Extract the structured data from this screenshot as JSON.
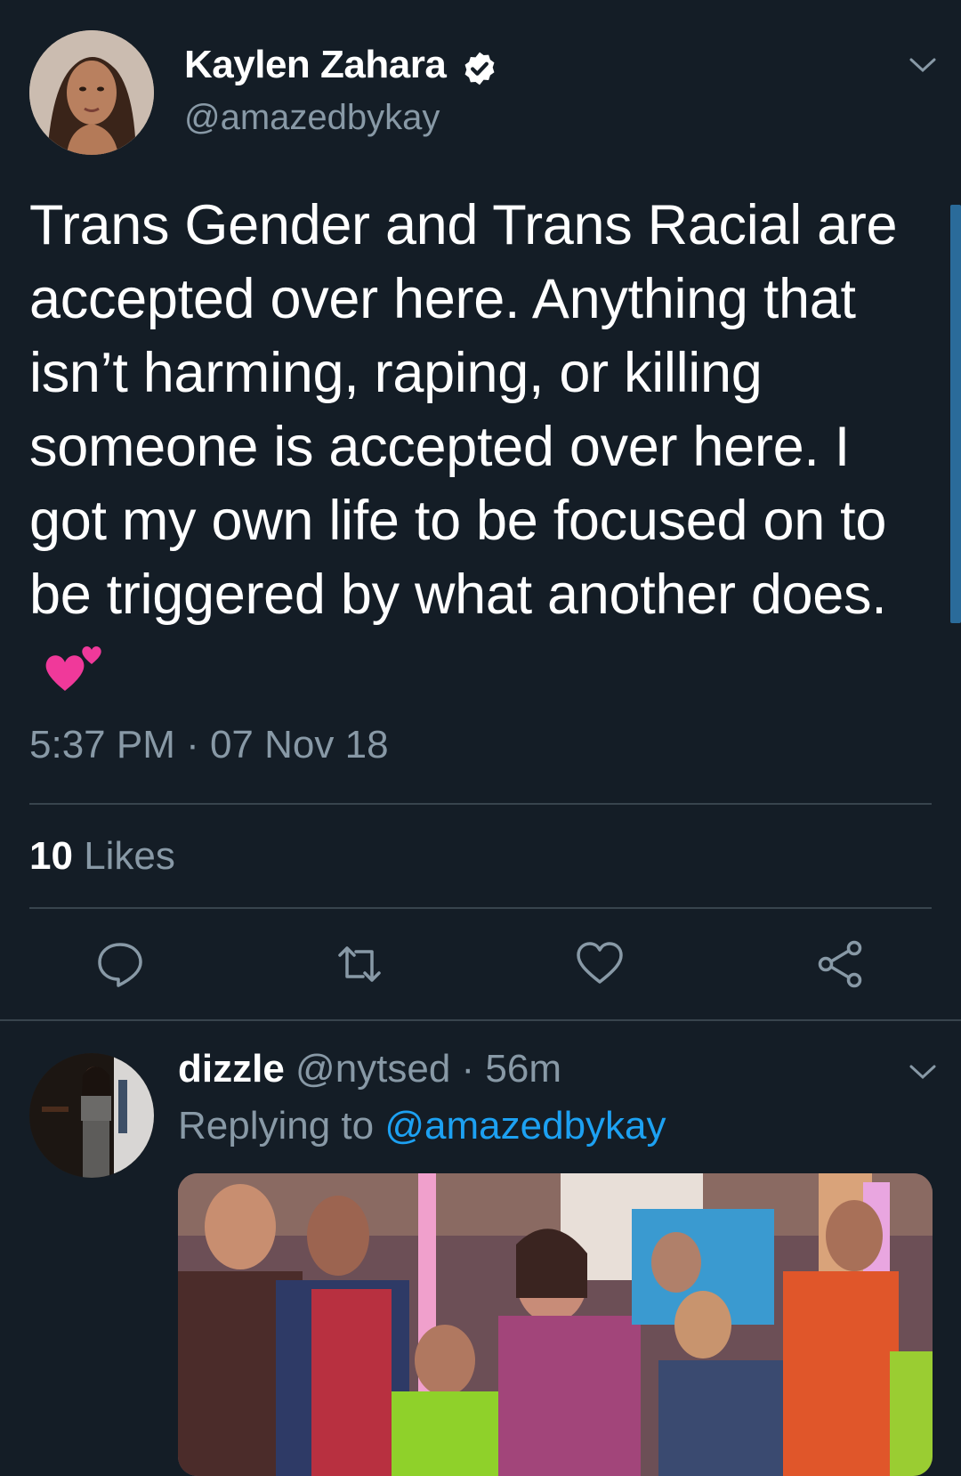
{
  "tweet": {
    "author_name": "Kaylen Zahara",
    "handle": "@amazedbykay",
    "text": "Trans Gender and Trans Racial are accepted over here. Anything that isn’t harming, raping, or killing someone is accepted over here. I got my own life to be focused on to be triggered by what another does.",
    "timestamp": "5:37 PM · 07 Nov 18",
    "likes_count": "10",
    "likes_label": "Likes"
  },
  "reply": {
    "author_name": "dizzle",
    "handle_time": "@nytsed · 56m",
    "replying_prefix": "Replying to",
    "replying_to": "@amazedbykay"
  },
  "icons": {
    "verified": "verified-badge-icon",
    "more": "chevron-down-icon",
    "reply": "reply-icon",
    "retweet": "retweet-icon",
    "like": "heart-icon",
    "share": "share-icon",
    "emoji": "two-hearts-emoji"
  },
  "colors": {
    "background": "#141d26",
    "secondary_text": "#8899a6",
    "link": "#1da1f2",
    "divider": "#38444d"
  }
}
